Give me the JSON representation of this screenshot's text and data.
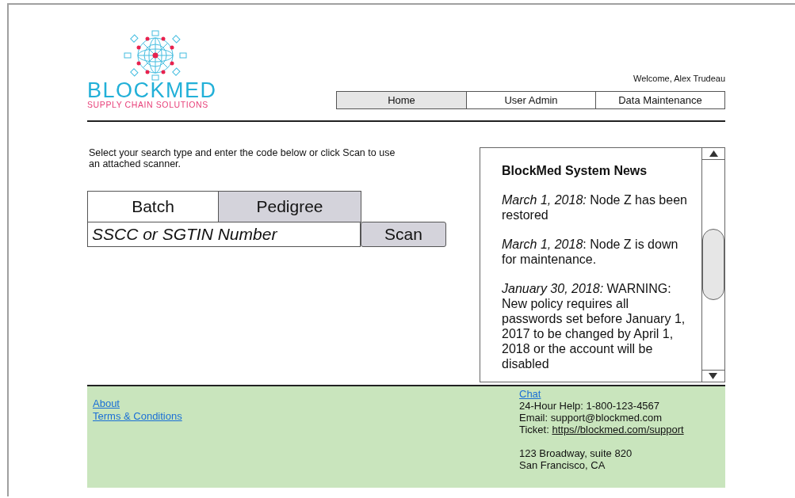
{
  "logo": {
    "name": "BLOCKMED",
    "tagline": "SUPPLY CHAIN SOLUTIONS"
  },
  "welcome": "Welcome, Alex Trudeau",
  "nav": [
    {
      "label": "Home",
      "selected": true
    },
    {
      "label": "User Admin",
      "selected": false
    },
    {
      "label": "Data Maintenance",
      "selected": false
    }
  ],
  "search": {
    "instructions": "Select your search type and enter the code below or click Scan to use an attached scanner.",
    "types": [
      {
        "label": "Batch",
        "selected": false
      },
      {
        "label": "Pedigree",
        "selected": true
      }
    ],
    "placeholder": "SSCC or SGTIN Number",
    "scan_button": "Scan"
  },
  "news": {
    "title": "BlockMed System News",
    "items": [
      "*March 1, 2018:* Node Z has been restored",
      "*March 1, 2018*: Node Z is down for maintenance.",
      "*January 30, 2018:* WARNING: New policy requires all passwords set before January 1, 2017 to be changed by April 1, 2018 or the account will be disabled"
    ]
  },
  "footer": {
    "links": [
      "About",
      "Terms & Conditions"
    ],
    "chat": "Chat",
    "help": "24-Hour Help: 1-800-123-4567",
    "email": "Email: support@blockmed.com",
    "ticket_label": "Ticket:",
    "ticket_link": "https//blockmed.com/support",
    "address": [
      "123 Broadway, suite 820",
      "San Francisco, CA"
    ]
  }
}
